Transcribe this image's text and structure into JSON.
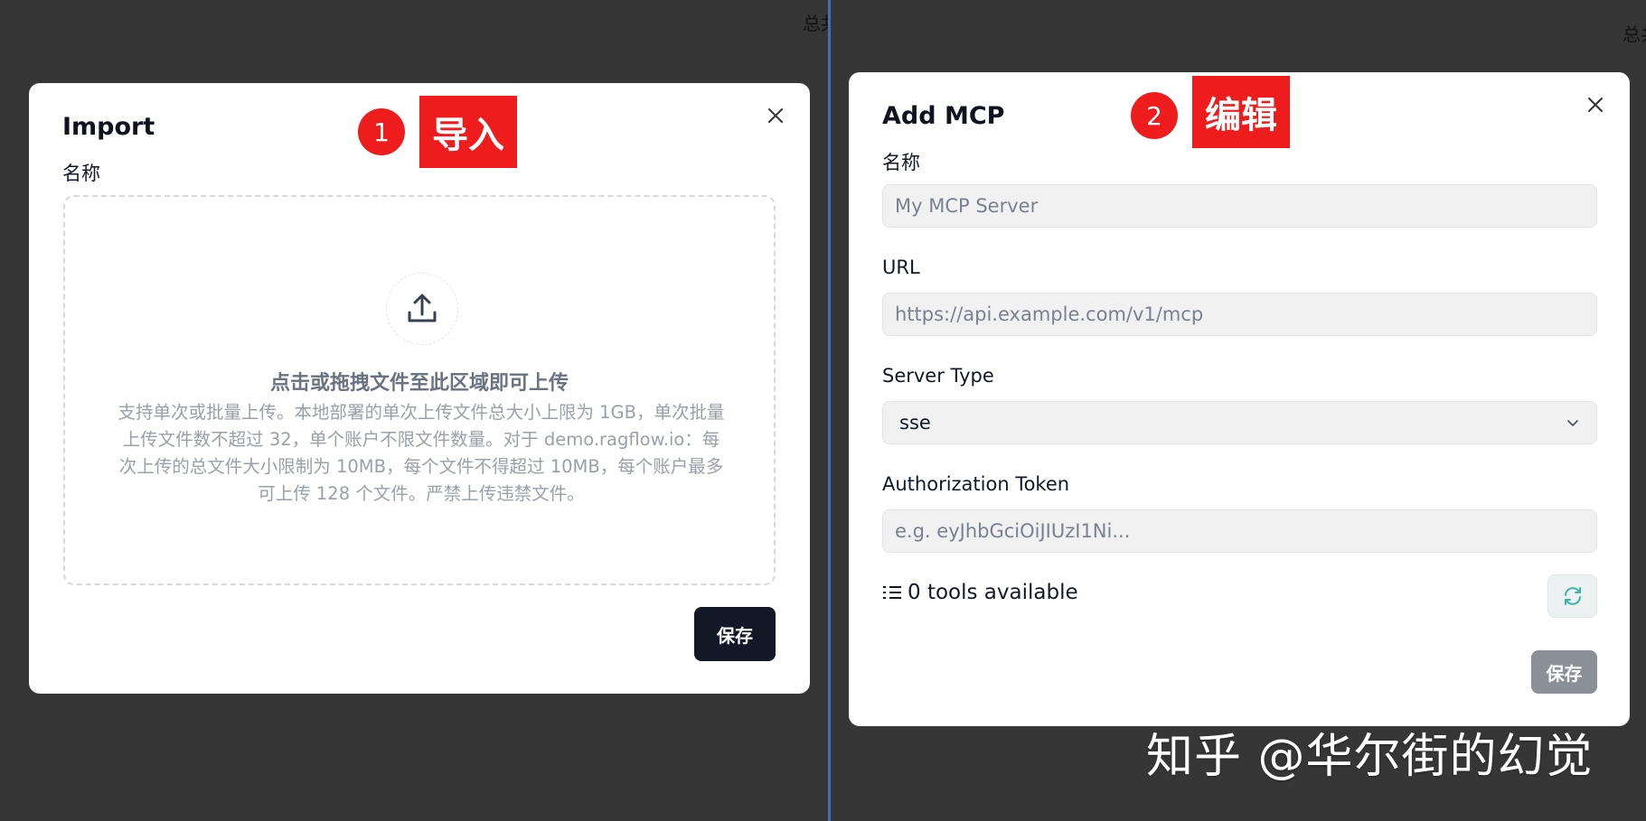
{
  "background": {
    "left_corner_text": "总共",
    "right_corner_text": "总共"
  },
  "import_modal": {
    "title": "Import",
    "name_label": "名称",
    "badge_number": "1",
    "badge_label": "导入",
    "dropzone": {
      "title": "点击或拖拽文件至此区域即可上传",
      "description": "支持单次或批量上传。本地部署的单次上传文件总大小上限为 1GB，单次批量上传文件数不超过 32，单个账户不限文件数量。对于 demo.ragflow.io：每次上传的总文件大小限制为 10MB，每个文件不得超过 10MB，每个账户最多可上传 128 个文件。严禁上传违禁文件。",
      "icon": "upload-icon"
    },
    "save_label": "保存"
  },
  "mcp_modal": {
    "title": "Add MCP",
    "badge_number": "2",
    "badge_label": "编辑",
    "name_label": "名称",
    "name_placeholder": "My MCP Server",
    "url_label": "URL",
    "url_placeholder": "https://api.example.com/v1/mcp",
    "server_type_label": "Server Type",
    "server_type_value": "sse",
    "auth_label": "Authorization Token",
    "auth_placeholder": "e.g. eyJhbGciOiJIUzI1Ni...",
    "tools_text": "0 tools available",
    "save_label": "保存"
  },
  "watermark": "知乎 @华尔街的幻觉",
  "colors": {
    "badge_red": "#ee1c1c",
    "save_dark": "#121826",
    "save_muted": "#8b8f97",
    "refresh_teal": "#3bb5a6"
  }
}
